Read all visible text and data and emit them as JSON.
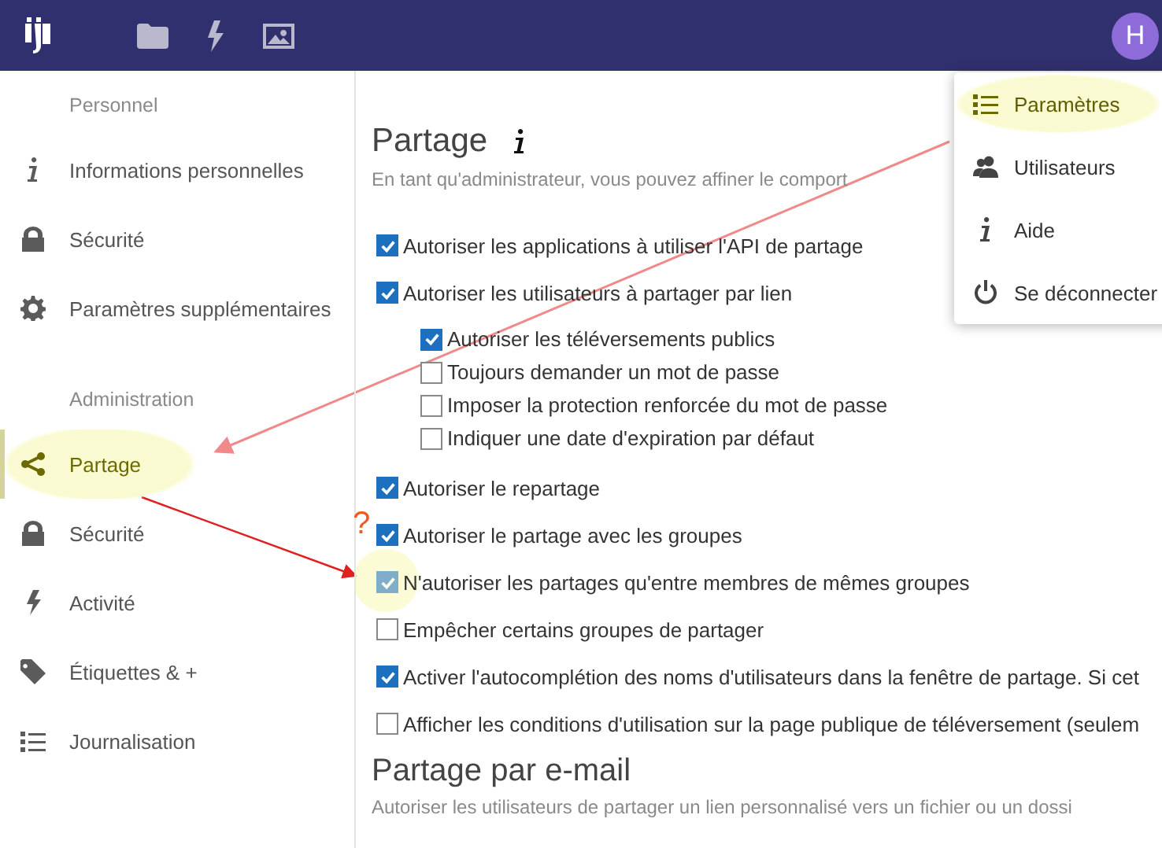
{
  "header": {
    "avatar": "H"
  },
  "sidebar": {
    "sections": [
      {
        "title": "Personnel",
        "items": [
          {
            "label": "Informations personnelles",
            "kind": "info",
            "selected": false,
            "highlighted": false
          },
          {
            "label": "Sécurité",
            "kind": "lock",
            "selected": false,
            "highlighted": false
          },
          {
            "label": "Paramètres supplémentaires",
            "kind": "gear",
            "selected": false,
            "highlighted": false
          }
        ]
      },
      {
        "title": "Administration",
        "items": [
          {
            "label": "Partage",
            "kind": "share",
            "selected": true,
            "highlighted": true
          },
          {
            "label": "Sécurité",
            "kind": "lock",
            "selected": false,
            "highlighted": false
          },
          {
            "label": "Activité",
            "kind": "bolt",
            "selected": false,
            "highlighted": false
          },
          {
            "label": "Étiquettes & +",
            "kind": "tag",
            "selected": false,
            "highlighted": false
          },
          {
            "label": "Journalisation",
            "kind": "list",
            "selected": false,
            "highlighted": false
          }
        ]
      }
    ]
  },
  "content": {
    "title": "Partage",
    "subtitle": "En tant qu'administrateur, vous pouvez affiner le comport",
    "options": [
      {
        "label": "Autoriser les applications à utiliser l'API de partage",
        "checked": true,
        "disabled": false,
        "highlighted": false
      },
      {
        "label": "Autoriser les utilisateurs à partager par lien",
        "checked": true,
        "disabled": false,
        "highlighted": false,
        "children": [
          {
            "label": "Autoriser les téléversements publics",
            "checked": true,
            "disabled": false,
            "highlighted": false
          },
          {
            "label": "Toujours demander un mot de passe",
            "checked": false,
            "disabled": false,
            "highlighted": false
          },
          {
            "label": "Imposer la protection renforcée du mot de passe",
            "checked": false,
            "disabled": false,
            "highlighted": false
          },
          {
            "label": "Indiquer une date d'expiration par défaut",
            "checked": false,
            "disabled": false,
            "highlighted": false
          }
        ]
      },
      {
        "label": "Autoriser le repartage",
        "checked": true,
        "disabled": false,
        "highlighted": false
      },
      {
        "label": "Autoriser le partage avec les groupes",
        "checked": true,
        "disabled": false,
        "highlighted": false
      },
      {
        "label": "N'autoriser les partages qu'entre membres de mêmes groupes",
        "checked": true,
        "disabled": true,
        "highlighted": true
      },
      {
        "label": "Empêcher certains groupes de partager",
        "checked": false,
        "disabled": false,
        "highlighted": false
      },
      {
        "label": "Activer l'autocomplétion des noms d'utilisateurs dans la fenêtre de partage. Si cet",
        "checked": true,
        "disabled": false,
        "highlighted": false
      },
      {
        "label": "Afficher les conditions d'utilisation sur la page publique de téléversement (seulem",
        "checked": false,
        "disabled": false,
        "highlighted": false
      }
    ],
    "section2": {
      "title": "Partage par e-mail",
      "subtitle": "Autoriser les utilisateurs de partager un lien personnalisé vers un fichier ou un dossi"
    }
  },
  "menu": {
    "items": [
      {
        "label": "Paramètres",
        "kind": "list",
        "highlighted": true
      },
      {
        "label": "Utilisateurs",
        "kind": "users",
        "highlighted": false
      },
      {
        "label": "Aide",
        "kind": "info",
        "highlighted": false
      },
      {
        "label": "Se déconnecter",
        "kind": "power",
        "highlighted": false
      }
    ]
  },
  "annotation": {
    "question_mark": "?"
  }
}
